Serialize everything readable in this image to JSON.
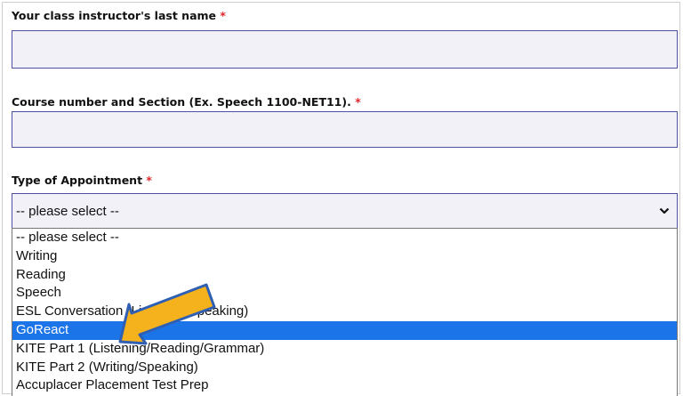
{
  "form": {
    "instructor_label": "Your class instructor's last name",
    "course_label": "Course number and Section (Ex. Speech 1100-NET11).",
    "appointment_label": "Type of Appointment",
    "required_marker": "*",
    "appointment_selected": "-- please select --",
    "appointment_options": [
      "-- please select --",
      "Writing",
      "Reading",
      "Speech",
      "ESL Conversation (Listening/Speaking)",
      "GoReact",
      "KITE Part 1 (Listening/Reading/Grammar)",
      "KITE Part 2 (Writing/Speaking)",
      "Accuplacer Placement Test Prep"
    ],
    "highlighted_option": "GoReact"
  },
  "colors": {
    "required": "#e0262b",
    "field_border": "#4b52a3",
    "field_bg": "#f2f1f8",
    "highlight": "#1b74e8",
    "arrow_fill": "#f6b21c",
    "arrow_stroke": "#2f5fb3"
  },
  "icons": {
    "select_chevron": "chevron-down-icon",
    "annotation": "arrow-pointer-icon"
  }
}
